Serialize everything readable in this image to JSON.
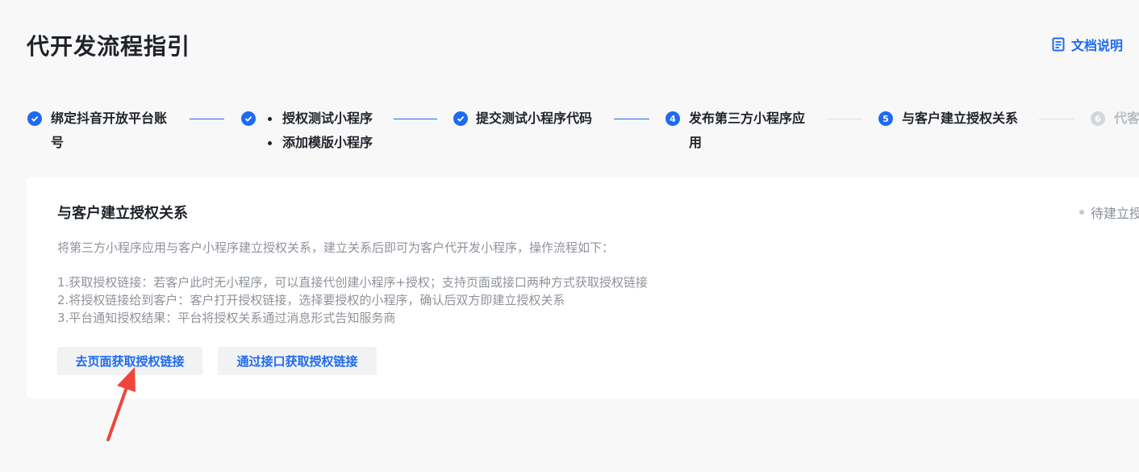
{
  "header": {
    "title": "代开发流程指引",
    "doc_link": "文档说明",
    "doc_icon": "document-icon"
  },
  "steps": [
    {
      "status": "done",
      "lines": [
        "绑定抖音开放平台账",
        "号"
      ]
    },
    {
      "status": "done",
      "bullets": [
        "授权测试小程序",
        "添加模版小程序"
      ]
    },
    {
      "status": "done",
      "lines": [
        "提交测试小程序代码"
      ]
    },
    {
      "status": "active",
      "number": "4",
      "lines": [
        "发布第三方小程序应",
        "用"
      ]
    },
    {
      "status": "active",
      "number": "5",
      "lines": [
        "与客户建立授权关系"
      ]
    },
    {
      "status": "pending",
      "number": "6",
      "lines": [
        "代客"
      ]
    }
  ],
  "card": {
    "title": "与客户建立授权关系",
    "status": "待建立授",
    "description": "将第三方小程序应用与客户小程序建立授权关系，建立关系后即可为客户代开发小程序，操作流程如下：",
    "instructions": [
      "1.获取授权链接：若客户此时无小程序，可以直接代创建小程序+授权；支持页面或接口两种方式获取授权链接",
      "2.将授权链接给到客户：客户打开授权链接，选择要授权的小程序，确认后双方即建立授权关系",
      "3.平台通知授权结果：平台将授权关系通过消息形式告知服务商"
    ],
    "buttons": {
      "page_link": "去页面获取授权链接",
      "api_link": "通过接口获取授权链接"
    }
  },
  "colors": {
    "accent": "#1e6af0",
    "annotation_arrow": "#f0453a"
  }
}
